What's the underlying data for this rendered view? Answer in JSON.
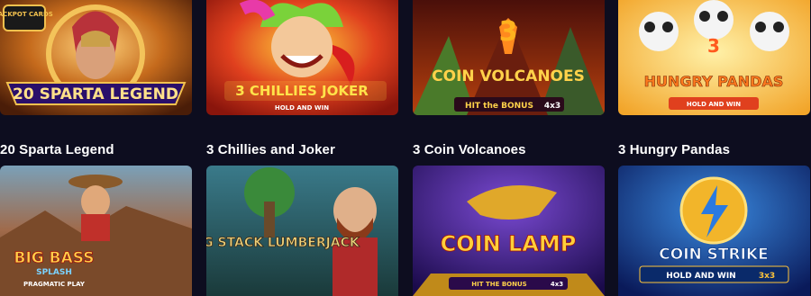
{
  "games": [
    {
      "title": "20 Sparta Legend",
      "logo_main": "20 SPARTA LEGEND",
      "badge": "JACKPOT CARDS",
      "colors": {
        "bg": "#7a3b12",
        "accent": "#f2c14e"
      }
    },
    {
      "title": "3 Chillies and Joker",
      "logo_main": "3 CHILLIES JOKER",
      "sub": "HOLD AND WIN",
      "colors": {
        "bg": "#d8321f",
        "accent": "#ffd43a"
      }
    },
    {
      "title": "3 Coin Volcanoes",
      "logo_num": "3",
      "logo_main": "COIN VOLCANOES",
      "sub": "HIT the BONUS",
      "sub_badge": "4x3",
      "colors": {
        "bg": "#8a2b0e",
        "accent": "#ffb21e"
      }
    },
    {
      "title": "3 Hungry Pandas",
      "logo_num": "3",
      "logo_main": "HUNGRY PANDAS",
      "sub": "HOLD AND WIN",
      "colors": {
        "bg": "#f6b53a",
        "accent": "#ff8a1e"
      }
    }
  ],
  "games_row2": [
    {
      "logo_main": "BIG BASS",
      "sub": "SPLASH",
      "provider": "PRAGMATIC PLAY",
      "colors": {
        "bg": "#6b4a3a",
        "accent": "#e23b2a"
      }
    },
    {
      "logo_main": "BIG STACK LUMBERJACK",
      "colors": {
        "bg": "#2c6c6a",
        "accent": "#f0d37a"
      }
    },
    {
      "logo_main": "COIN LAMP",
      "sub": "HIT THE BONUS",
      "sub_badge": "4x3",
      "colors": {
        "bg": "#3a1f7a",
        "accent": "#ffcf3a"
      }
    },
    {
      "logo_main": "COIN STRIKE",
      "sub": "HOLD AND WIN",
      "sub_badge": "3x3",
      "colors": {
        "bg": "#0e2a7a",
        "accent": "#ffc43a"
      }
    }
  ]
}
